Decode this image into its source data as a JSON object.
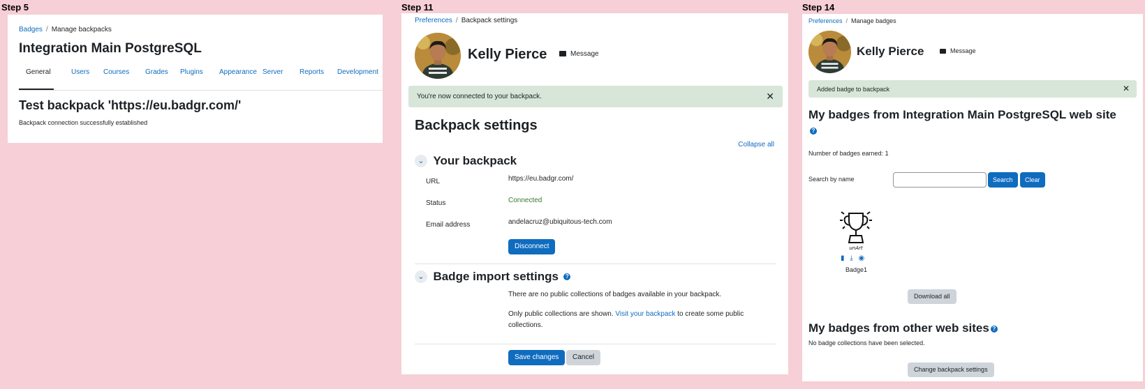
{
  "steps": [
    "Step 5",
    "Step 11",
    "Step 14"
  ],
  "p1": {
    "breadcrumb": [
      "Badges",
      "Manage backpacks"
    ],
    "site_title": "Integration Main PostgreSQL",
    "tabs": [
      "General",
      "Users",
      "Courses",
      "Grades",
      "Plugins",
      "Appearance",
      "Server",
      "Reports",
      "Development"
    ],
    "heading": "Test backpack 'https://eu.badgr.com/'",
    "message": "Backpack connection successfully established"
  },
  "p2": {
    "breadcrumb": [
      "Preferences",
      "Backpack settings"
    ],
    "user_name": "Kelly Pierce",
    "message_button": "Message",
    "alert": "You're now connected to your backpack.",
    "heading": "Backpack settings",
    "collapse_all": "Collapse all",
    "section_backpack": "Your backpack",
    "url_label": "URL",
    "url_value": "https://eu.badgr.com/",
    "status_label": "Status",
    "status_value": "Connected",
    "email_label": "Email address",
    "email_value": "andelacruz@ubiquitous-tech.com",
    "disconnect": "Disconnect",
    "section_import": "Badge import settings",
    "import_text": "There are no public collections of badges available in your backpack.",
    "only_public_pre": "Only public collections are shown.",
    "visit_link": "Visit your backpack",
    "only_public_post": "to create some public",
    "only_public_post2": "collections.",
    "save": "Save changes",
    "cancel": "Cancel"
  },
  "p3": {
    "breadcrumb": [
      "Preferences",
      "Manage badges"
    ],
    "user_name": "Kelly Pierce",
    "message_button": "Message",
    "alert": "Added badge to backpack",
    "heading": "My badges from Integration Main PostgreSQL web site",
    "count": "Number of badges earned: 1",
    "search_label": "Search by name",
    "search_button": "Search",
    "clear_button": "Clear",
    "badge_name": "Badge1",
    "download_all": "Download all",
    "other_heading": "My badges from other web sites",
    "no_collections": "No badge collections have been selected.",
    "change_settings": "Change backpack settings"
  },
  "colors": {
    "background": "#f7cfd6",
    "link": "#0f6cbf",
    "success_bg": "#d7e6d8",
    "success_text": "#357a32"
  }
}
